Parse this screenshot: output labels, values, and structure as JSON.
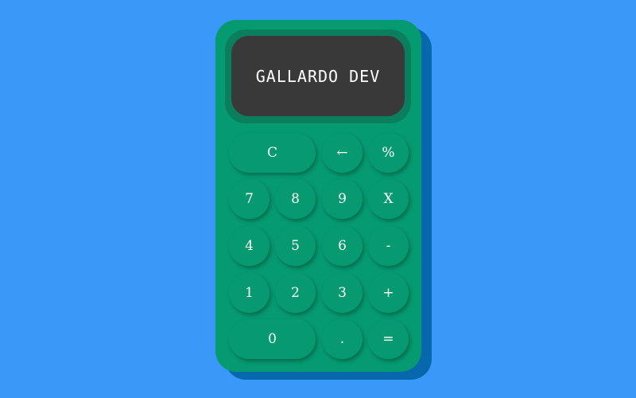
{
  "display": {
    "text": "GALLARDO DEV"
  },
  "keys": {
    "clear": "C",
    "backspace": "←",
    "percent": "%",
    "seven": "7",
    "eight": "8",
    "nine": "9",
    "multiply": "X",
    "four": "4",
    "five": "5",
    "six": "6",
    "subtract": "-",
    "one": "1",
    "two": "2",
    "three": "3",
    "add": "+",
    "zero": "0",
    "decimal": ".",
    "equals": "="
  },
  "colors": {
    "background": "#3a99f8",
    "body": "#069a70",
    "body_shadow": "#0868ad",
    "display_bezel": "#0a7f5d",
    "display": "#393939",
    "text": "#ffffff"
  }
}
